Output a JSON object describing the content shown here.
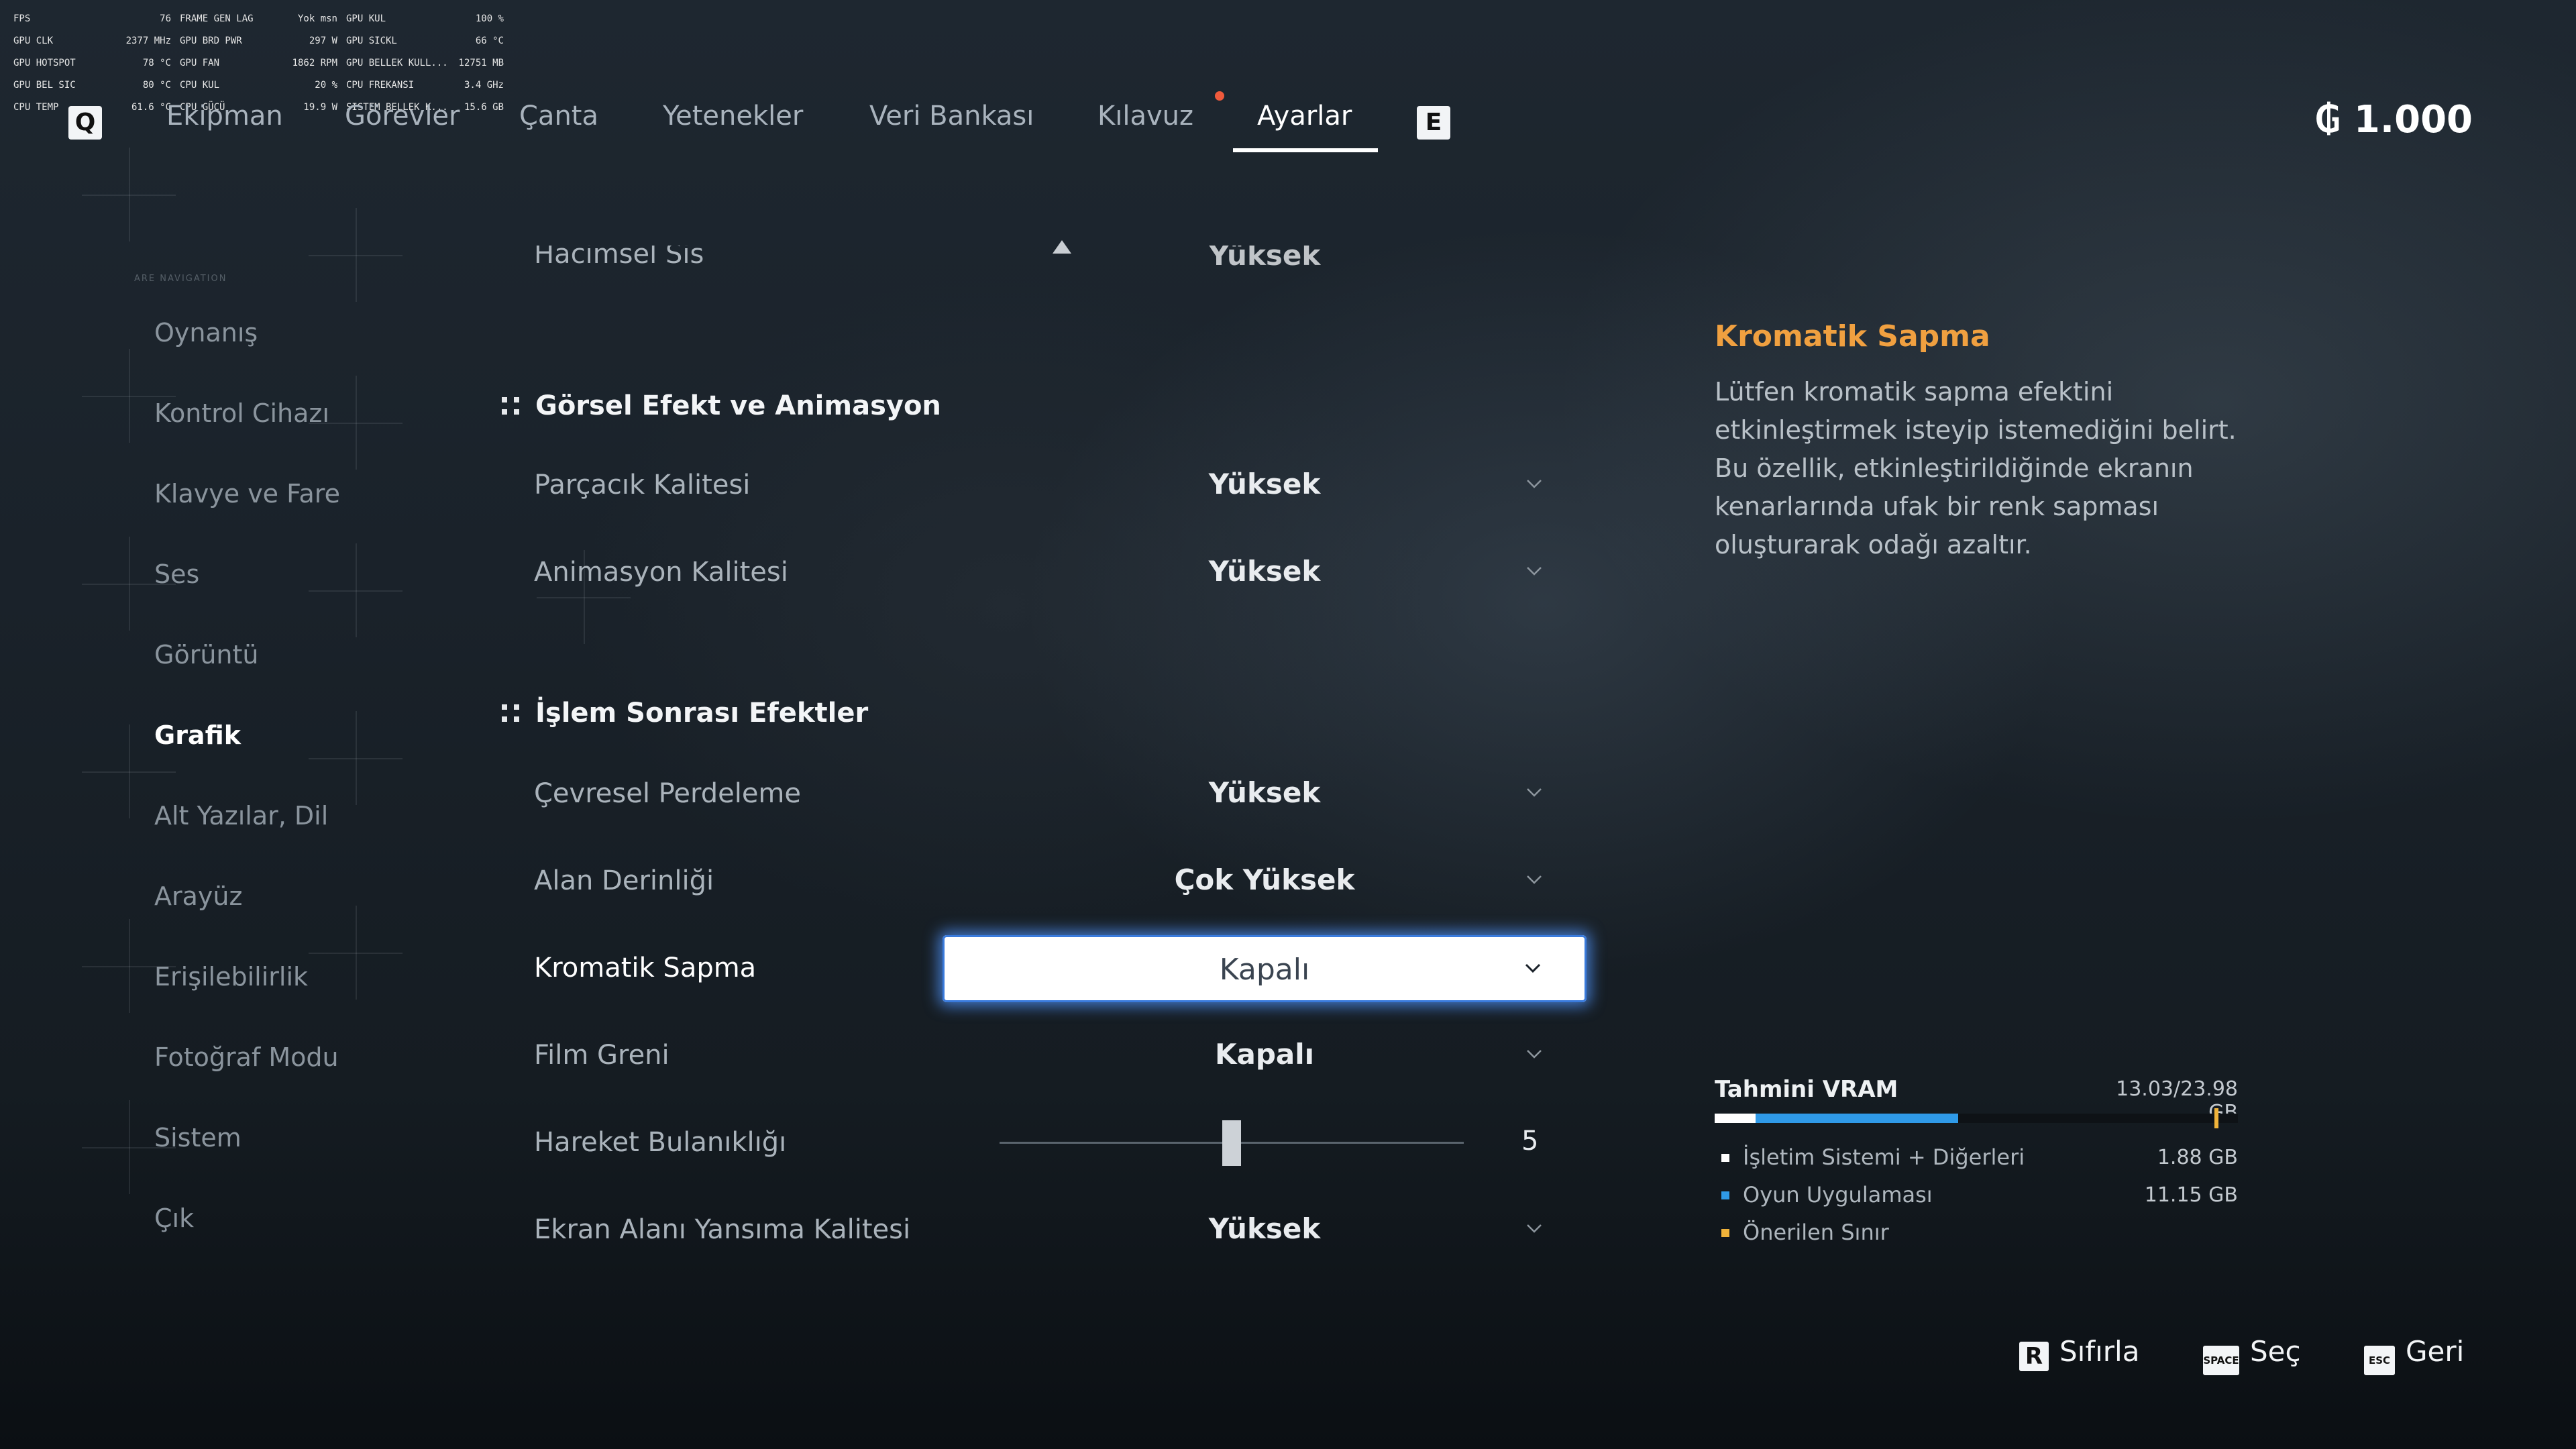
{
  "perf_overlay": {
    "col1": [
      {
        "label": "FPS",
        "value": "76"
      },
      {
        "label": "GPU CLK",
        "value": "2377 MHz"
      },
      {
        "label": "GPU HOTSPOT",
        "value": "78 °C"
      },
      {
        "label": "GPU BEL SIC",
        "value": "80 °C"
      },
      {
        "label": "CPU TEMP",
        "value": "61.6 °C"
      }
    ],
    "col2": [
      {
        "label": "FRAME GEN LAG",
        "value": "Yok msn"
      },
      {
        "label": "GPU BRD PWR",
        "value": "297 W"
      },
      {
        "label": "GPU FAN",
        "value": "1862 RPM"
      },
      {
        "label": "CPU KUL",
        "value": "20 %"
      },
      {
        "label": "CPU GÜCÜ",
        "value": "19.9 W"
      }
    ],
    "col3": [
      {
        "label": "GPU KUL",
        "value": "100 %"
      },
      {
        "label": "GPU SICKL",
        "value": "66 °C"
      },
      {
        "label": "GPU BELLEK KULL...",
        "value": "12751 MB"
      },
      {
        "label": "CPU FREKANSI",
        "value": "3.4 GHz"
      },
      {
        "label": "SISTEM BELLEK K...",
        "value": "15.6 GB"
      }
    ]
  },
  "nav": {
    "prev_key": "Q",
    "next_key": "E",
    "tabs": [
      "Ekipman",
      "Görevler",
      "Çanta",
      "Yetenekler",
      "Veri Bankası",
      "Kılavuz",
      "Ayarlar"
    ],
    "active_tab": "Ayarlar",
    "currency": "₲ 1.000"
  },
  "sidebar": {
    "items": [
      "Oynanış",
      "Kontrol Cihazı",
      "Klavye ve Fare",
      "Ses",
      "Görüntü",
      "Grafik",
      "Alt Yazılar, Dil",
      "Arayüz",
      "Erişilebilirlik",
      "Fotoğraf Modu",
      "Sistem",
      "Çık"
    ],
    "active": "Grafik",
    "decor_text": "ARE NAVIGATION"
  },
  "settings": {
    "clipped_row": {
      "label": "Hacimsel Sis",
      "value": "Yüksek"
    },
    "section1": "Görsel Efekt ve Animasyon",
    "rows1": [
      {
        "label": "Parçacık Kalitesi",
        "value": "Yüksek"
      },
      {
        "label": "Animasyon Kalitesi",
        "value": "Yüksek"
      }
    ],
    "section2": "İşlem Sonrası Efektler",
    "rows2": [
      {
        "label": "Çevresel Perdeleme",
        "value": "Yüksek"
      },
      {
        "label": "Alan Derinliği",
        "value": "Çok Yüksek"
      },
      {
        "label": "Kromatik Sapma",
        "value": "Kapalı"
      },
      {
        "label": "Film Greni",
        "value": "Kapalı"
      },
      {
        "label": "Hareket Bulanıklığı",
        "value": "5"
      },
      {
        "label": "Ekran Alanı Yansıma Kalitesi",
        "value": "Yüksek"
      }
    ],
    "slider_fraction": 0.5
  },
  "description": {
    "title": "Kromatik Sapma",
    "text": "Lütfen kromatik sapma efektini etkinleştirmek isteyip istemediğini belirt. Bu özellik, etkinleştirildiğinde ekranın kenarlarında ufak bir renk sapması oluşturarak odağı azaltır."
  },
  "vram": {
    "title": "Tahmini VRAM",
    "total": "13.03/23.98 GB",
    "items": [
      {
        "label": "İşletim Sistemi + Diğerleri",
        "value": "1.88 GB",
        "color": "#ffffff"
      },
      {
        "label": "Oyun Uygulaması",
        "value": "11.15 GB",
        "color": "#2f9ae8"
      },
      {
        "label": "Önerilen Sınır",
        "value": "",
        "color": "#f0b33a"
      }
    ],
    "os_fraction": 0.078,
    "game_fraction": 0.465,
    "limit_fraction": 0.955
  },
  "hints": [
    {
      "key": "R",
      "label": "Sıfırla"
    },
    {
      "key": "SPACE",
      "label": "Seç"
    },
    {
      "key": "ESC",
      "label": "Geri"
    }
  ]
}
